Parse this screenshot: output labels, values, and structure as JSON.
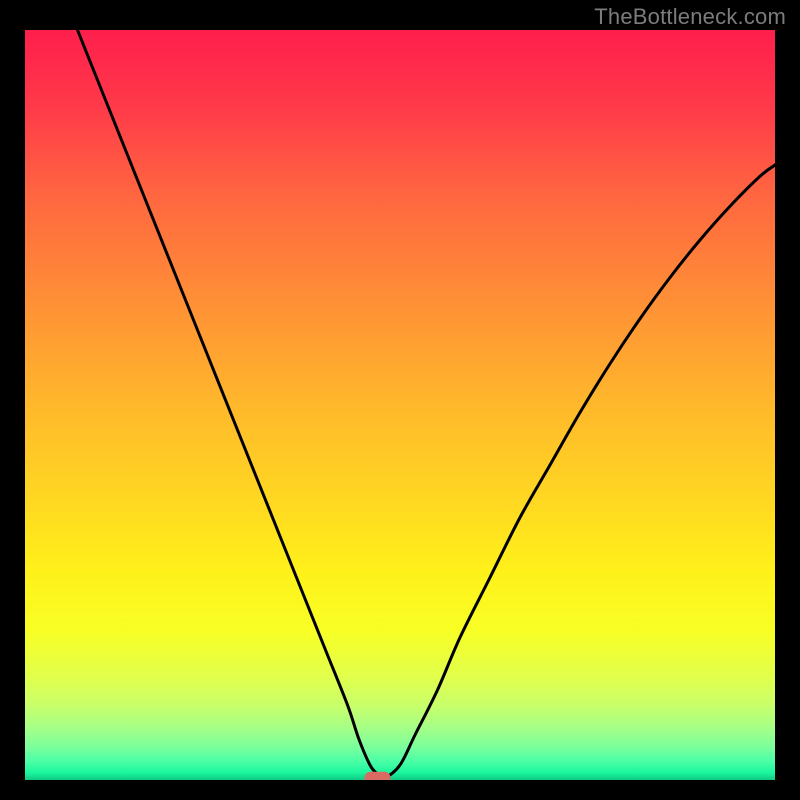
{
  "watermark": "TheBottleneck.com",
  "chart_data": {
    "type": "line",
    "title": "",
    "xlabel": "",
    "ylabel": "",
    "xlim": [
      0,
      100
    ],
    "ylim": [
      0,
      100
    ],
    "grid": false,
    "legend": "none",
    "series": [
      {
        "name": "bottleneck-curve",
        "x": [
          7,
          10,
          13,
          16,
          19,
          22,
          25,
          28,
          31,
          34,
          37,
          40,
          43,
          44.5,
          46,
          47,
          48,
          50,
          52,
          55,
          58,
          62,
          66,
          70,
          74,
          78,
          82,
          86,
          90,
          94,
          98,
          100
        ],
        "y": [
          100,
          92.5,
          85,
          77.5,
          70,
          62.5,
          55,
          47.5,
          40,
          32.5,
          25,
          17.5,
          10,
          5.5,
          2,
          0.8,
          0.3,
          2,
          6,
          12,
          19,
          27,
          35,
          42,
          49,
          55.5,
          61.5,
          67,
          72,
          76.5,
          80.5,
          82
        ]
      }
    ],
    "marker": {
      "name": "sweet-spot",
      "x": 47,
      "y": 0.3,
      "color": "#d96b63"
    },
    "background_gradient": {
      "stops": [
        {
          "offset": 0.0,
          "color": "#ff1f4c"
        },
        {
          "offset": 0.1,
          "color": "#ff394a"
        },
        {
          "offset": 0.22,
          "color": "#ff6640"
        },
        {
          "offset": 0.36,
          "color": "#ff8f36"
        },
        {
          "offset": 0.5,
          "color": "#ffb82b"
        },
        {
          "offset": 0.62,
          "color": "#ffd622"
        },
        {
          "offset": 0.72,
          "color": "#fff01a"
        },
        {
          "offset": 0.8,
          "color": "#f8ff25"
        },
        {
          "offset": 0.86,
          "color": "#e2ff4a"
        },
        {
          "offset": 0.9,
          "color": "#c9ff6a"
        },
        {
          "offset": 0.93,
          "color": "#a6ff86"
        },
        {
          "offset": 0.955,
          "color": "#7dff9b"
        },
        {
          "offset": 0.975,
          "color": "#4bffa6"
        },
        {
          "offset": 0.99,
          "color": "#1cf79e"
        },
        {
          "offset": 1.0,
          "color": "#0fc986"
        }
      ]
    }
  }
}
